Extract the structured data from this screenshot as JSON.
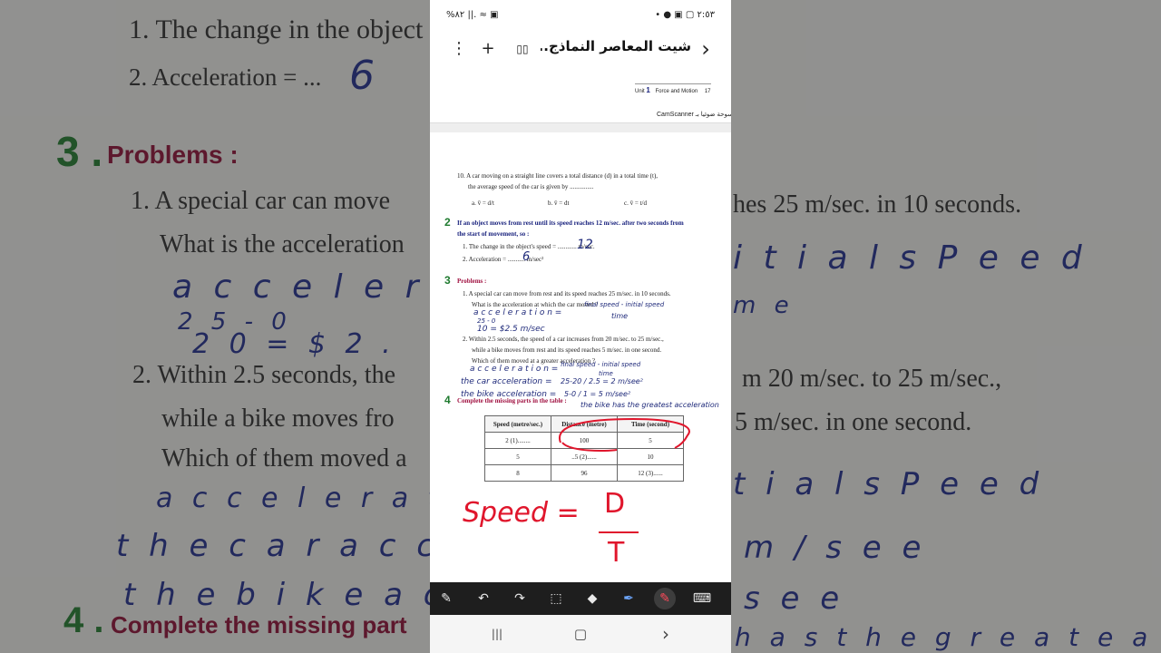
{
  "background": {
    "q1": "1. The change in the object",
    "q2": "2. Acceleration = ...",
    "q2_hw": "6",
    "num3": "3 .",
    "problems": "Problems :",
    "p1": "1. A special car can move",
    "p1_right": "hes 25 m/sec. in 10 seconds.",
    "p1b": "What is the acceleration",
    "hw1": "a c c e l e r a t i",
    "hw1_right": "i t i a l s P e e d",
    "hw_frac": "2 5 - 0",
    "hw_frac_r": "m e",
    "hw_frac2": "2 0   =  $ 2 .",
    "p2": "2. Within 2.5 seconds, the",
    "p2_right": "m 20 m/sec. to 25 m/sec.,",
    "p2b": "while a bike moves fro",
    "p2b_right": "5 m/sec. in one second.",
    "p2c": "Which of them moved a",
    "hw2": "a c c e l e r a t i o",
    "hw2_right": "t i a l s P e e d",
    "hw3": "t h e c a r a c c e l e r a",
    "hw3_right": "m / s e e",
    "hw4": "t h e b i k e a c c e l e",
    "hw4_right": "s e e",
    "num4": "4 .",
    "complete": "Complete the missing part",
    "hw5_right": "h a s t h e g r e a t e a c c e l e r"
  },
  "status": {
    "left": "%٨٢ ||. ≈ ▣",
    "right": "• ● ▣ ▢ ٢:٥٣"
  },
  "toolbar": {
    "title": "شيت المعاصر النماذج...",
    "more_icon": "⋮",
    "add_icon": "+",
    "book_icon": "▯▯",
    "forward_icon": "›"
  },
  "prev_page": {
    "unit_label": "Unit",
    "unit_num": "1",
    "unit_title": "Force and Motion",
    "page_num": "17",
    "scanner": "CamScanner مسوحة ضوئيا بـ"
  },
  "page": {
    "q10": "10. A car moving on a straight line covers a total distance (d) in a total time (t),",
    "q10b": "the average speed of the car is given by ...............",
    "q10a": "a. v̄ = d/t",
    "q10bopt": "b. v̄ = dt",
    "q10c": "c. v̄ = t/d",
    "n2": "2",
    "q2": "If an object moves from rest until its speed reaches 12 m/sec. after two seconds from",
    "q2b": "the start of movement, so :",
    "q2_1": "1. The change in the object's speed = ............ m/sec.",
    "q2_1hw": "12",
    "q2_2": "2. Acceleration = ........... m/sec²",
    "q2_2hw": "6",
    "n3": "3",
    "problems": "Problems :",
    "p1": "1. A special car can move from rest and its speed reaches 25 m/sec. in 10 seconds.",
    "p1b": "What is the acceleration at which the car moved ?",
    "hw_a1": "a c c e l e r a t i o n =",
    "hw_a1r": "final speed - initial speed",
    "hw_a1t": "time",
    "hw_a2": "25 - 0",
    "hw_a3": "10  = $2.5 m/sec",
    "p2": "2. Within 2.5 seconds, the speed of a car increases from 20 m/sec. to 25 m/sec.,",
    "p2b": "while a bike moves from rest and its speed reaches 5 m/sec. in one second.",
    "p2c": "Which of them moved at a greater acceleration ?",
    "hw_b1": "a c c e l e r a t i o n =",
    "hw_b1r": "final speed - initial speed",
    "hw_b1t": "time",
    "hw_b2": "the car acceleration =",
    "hw_b2r": "25-20 / 2.5  = 2 m/see²",
    "hw_b3": "the bike acceleration =",
    "hw_b3r": "5-0 / 1  = 5 m/see²",
    "hw_b4": "the bike has the greatest acceleration",
    "n4": "4",
    "q4": "Complete the missing parts in the table :",
    "table": {
      "headers": [
        "Speed (metre/sec.)",
        "Distance (metre)",
        "Time (second)"
      ],
      "rows": [
        [
          "2 (1)........",
          "100",
          "5"
        ],
        [
          "5",
          "..5 (2)......",
          "10"
        ],
        [
          "8",
          "96",
          "12 (3)......"
        ]
      ]
    },
    "hw_speed": "Speed =",
    "hw_d": "D",
    "hw_t": "T"
  },
  "pen_toolbar": {
    "tools": [
      "✎",
      "↶",
      "↷",
      "⬚",
      "◆",
      "✒",
      "✎",
      "⌨"
    ]
  },
  "nav": {
    "recents": "|||",
    "home": "▢",
    "back": "›"
  }
}
